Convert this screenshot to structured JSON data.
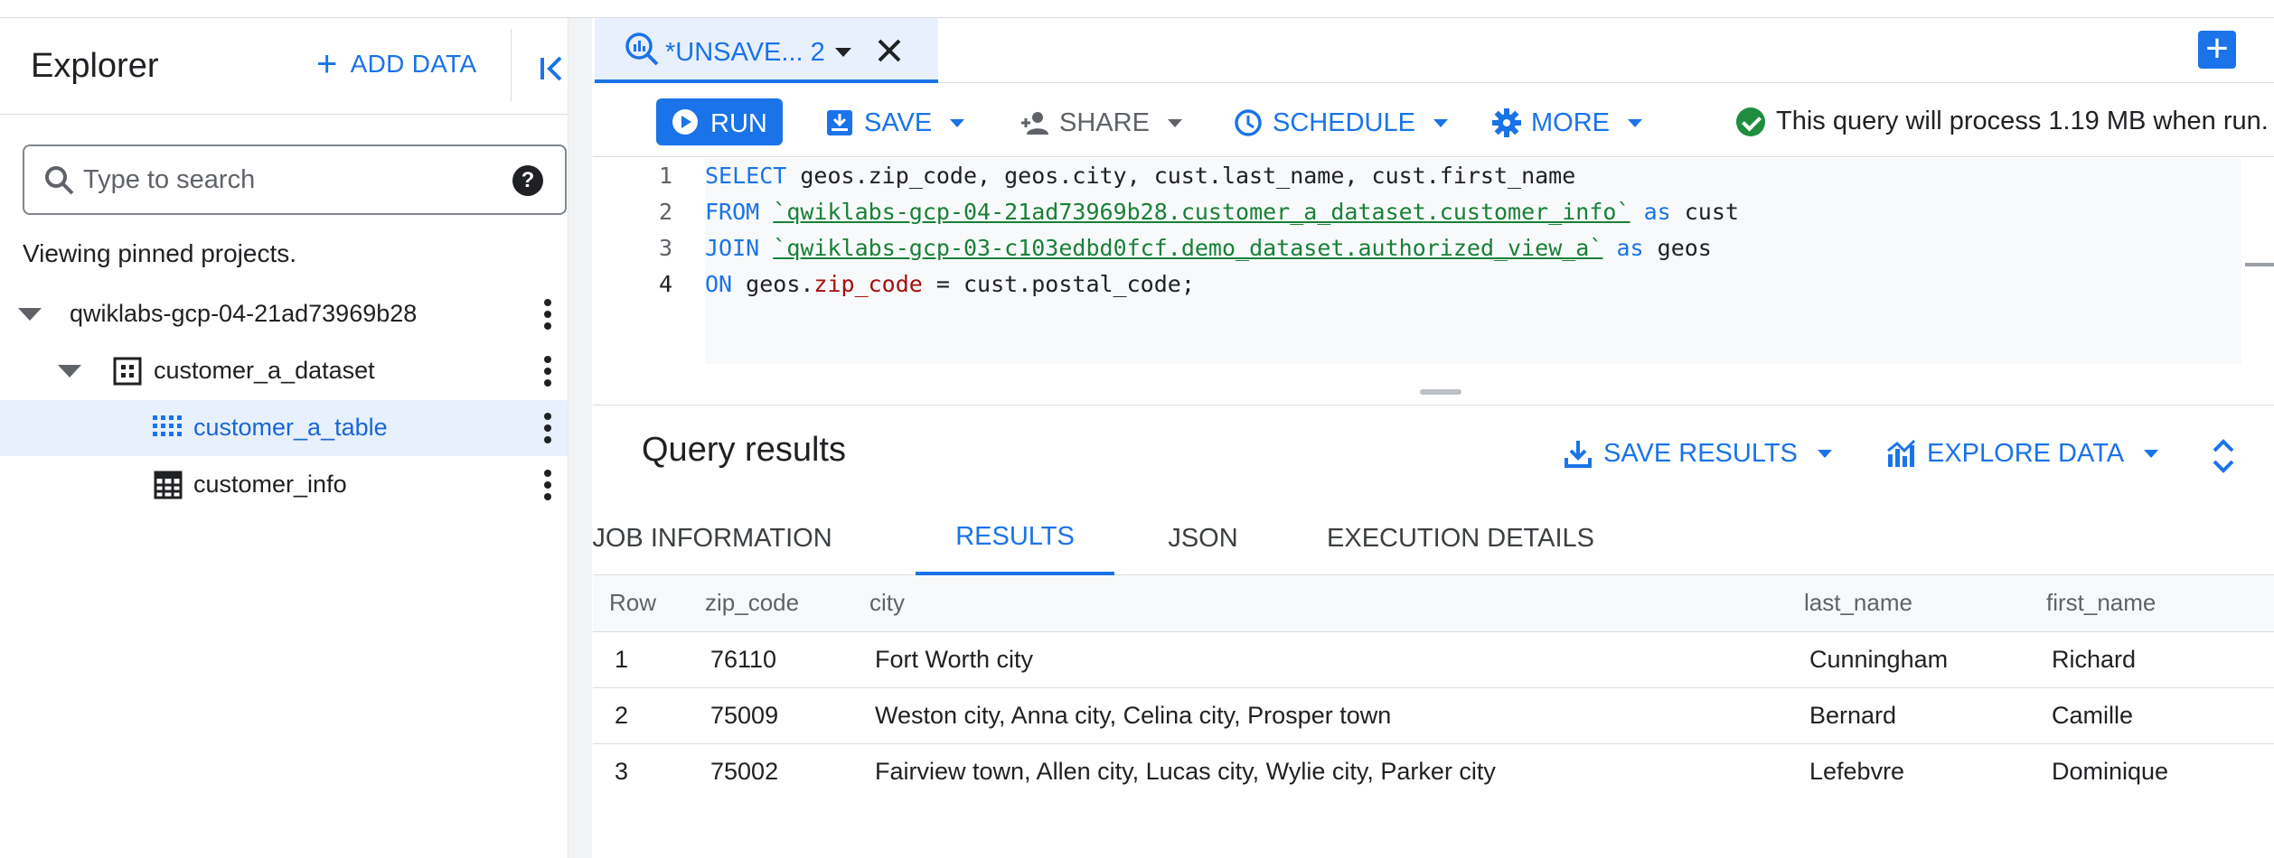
{
  "explorer": {
    "title": "Explorer",
    "add_data_label": "ADD DATA",
    "search": {
      "placeholder": "Type to search",
      "value": ""
    },
    "pinned_note": "Viewing pinned projects.",
    "tree": [
      {
        "label": "qwiklabs-gcp-04-21ad73969b28",
        "level": "project",
        "expanded": true,
        "selected": false
      },
      {
        "label": "customer_a_dataset",
        "level": "dataset",
        "expanded": true,
        "selected": false
      },
      {
        "label": "customer_a_table",
        "level": "view",
        "selected": true
      },
      {
        "label": "customer_info",
        "level": "table",
        "selected": false
      }
    ]
  },
  "editor_tab": {
    "label": "*UNSAVE... 2"
  },
  "toolbar": {
    "run_label": "RUN",
    "save_label": "SAVE",
    "share_label": "SHARE",
    "schedule_label": "SCHEDULE",
    "more_label": "MORE",
    "validator_text": "This query will process 1.19 MB when run."
  },
  "editor": {
    "line_numbers": [
      "1",
      "2",
      "3",
      "4"
    ],
    "lines": [
      {
        "kw": "SELECT",
        "rest": " geos.zip_code, geos.city, cust.last_name, cust.first_name"
      },
      {
        "kw": "FROM",
        "str": "`qwiklabs-gcp-04-21ad73969b28.customer_a_dataset.customer_info`",
        "kw2": "as",
        "rest": " cust"
      },
      {
        "kw": "JOIN",
        "str": "`qwiklabs-gcp-03-c103edbd0fcf.demo_dataset.authorized_view_a`",
        "kw2": "as",
        "rest": " geos"
      },
      {
        "kw": "ON",
        "pre": " geos.",
        "field": "zip_code",
        "rest": " = cust.postal_code;"
      }
    ]
  },
  "results": {
    "title": "Query results",
    "save_results_label": "SAVE RESULTS",
    "explore_data_label": "EXPLORE DATA",
    "tabs": [
      "JOB INFORMATION",
      "RESULTS",
      "JSON",
      "EXECUTION DETAILS"
    ],
    "active_tab": "RESULTS",
    "columns": [
      "Row",
      "zip_code",
      "city",
      "last_name",
      "first_name"
    ],
    "rows": [
      [
        "1",
        "76110",
        "Fort Worth city",
        "Cunningham",
        "Richard"
      ],
      [
        "2",
        "75009",
        "Weston city, Anna city, Celina city, Prosper town",
        "Bernard",
        "Camille"
      ],
      [
        "3",
        "75002",
        "Fairview town, Allen city, Lucas city, Wylie city, Parker city",
        "Lefebvre",
        "Dominique"
      ]
    ]
  },
  "colors": {
    "accent": "#1a73e8",
    "selected_row": "#e8f0fe",
    "success": "#1e8e3e",
    "string_literal": "#188038"
  },
  "icons": [
    "plus-icon",
    "collapse-panel-icon",
    "search-icon",
    "help-icon",
    "caret-down-icon",
    "dataset-icon",
    "view-icon",
    "table-icon",
    "more-vert-icon",
    "query-icon",
    "close-icon",
    "add-tab-icon",
    "play-icon",
    "save-icon",
    "share-icon",
    "schedule-icon",
    "settings-icon",
    "check-circle-icon",
    "download-icon",
    "chart-icon",
    "expand-icon"
  ]
}
